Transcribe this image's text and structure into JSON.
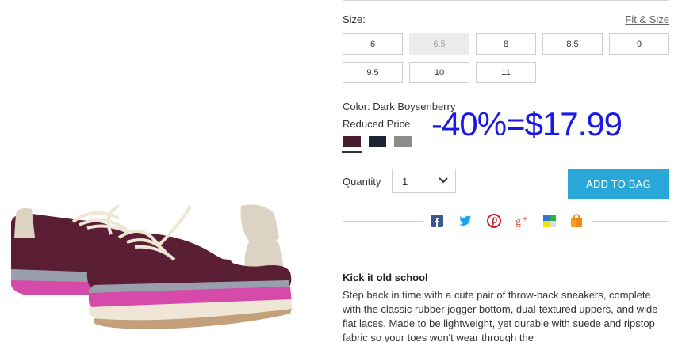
{
  "sizes": {
    "label": "Size:",
    "fit_link": "Fit & Size",
    "options": [
      "6",
      "6.5",
      "8",
      "8.5",
      "9",
      "9.5",
      "10",
      "11"
    ],
    "unavailable": [
      "6.5"
    ]
  },
  "color": {
    "label": "Color: Dark Boysenberry",
    "price_label": "Reduced Price",
    "swatches": [
      {
        "name": "Dark Boysenberry",
        "hex": "#4a1c30",
        "selected": true
      },
      {
        "name": "Navy",
        "hex": "#1c2433",
        "selected": false
      },
      {
        "name": "Gray",
        "hex": "#8c8c8c",
        "selected": false
      }
    ]
  },
  "annotation": {
    "text": "-40%=$17.99",
    "color": "#1a1ae6"
  },
  "quantity": {
    "label": "Quantity",
    "value": "1"
  },
  "add_to_bag": {
    "label": "ADD TO BAG",
    "color": "#2aa7d9"
  },
  "share_icons": [
    "facebook-icon",
    "twitter-icon",
    "pinterest-icon",
    "google-plus-icon",
    "delicious-icon",
    "shopping-bag-icon"
  ],
  "description": {
    "title": "Kick it old school",
    "text": "Step back in time with a cute pair of throw-back sneakers, complete with the classic rubber jogger bottom, dual-textured uppers, and wide flat laces. Made to be lightweight, yet durable with suede and ripstop fabric so your toes won't wear through the"
  }
}
